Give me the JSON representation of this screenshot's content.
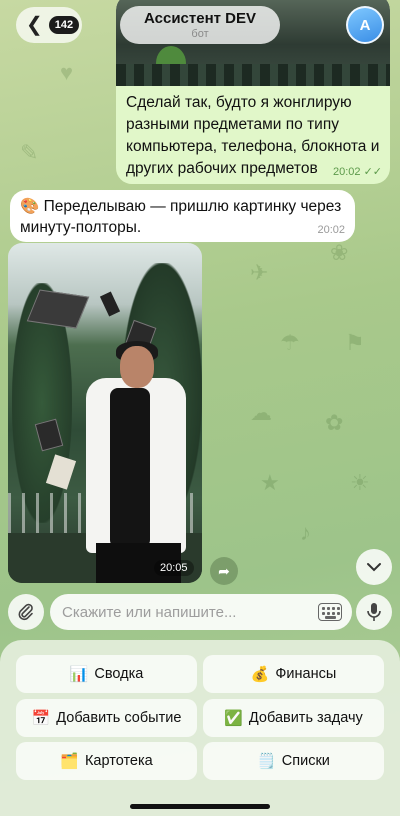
{
  "header": {
    "back_count": "142",
    "title": "Ассистент DEV",
    "subtitle": "бот",
    "avatar_letter": "A"
  },
  "messages": {
    "outgoing": {
      "text": "Сделай так, будто я жонглирую разными предметами по типу компьютера, телефона, блокнота и других рабочих предметов",
      "time": "20:02"
    },
    "incoming_text": {
      "emoji": "🎨",
      "text": "Переделываю — пришлю картинку через минуту-полторы.",
      "time": "20:02"
    },
    "incoming_photo": {
      "time": "20:05"
    }
  },
  "input": {
    "placeholder": "Скажите или напишите..."
  },
  "keyboard": {
    "buttons": [
      {
        "emoji": "📊",
        "label": "Сводка"
      },
      {
        "emoji": "💰",
        "label": "Финансы"
      },
      {
        "emoji": "📅",
        "label": "Добавить событие"
      },
      {
        "emoji": "✅",
        "label": "Добавить задачу"
      },
      {
        "emoji": "🗂️",
        "label": "Картотека"
      },
      {
        "emoji": "🗒️",
        "label": "Списки"
      }
    ]
  },
  "colors": {
    "outgoing_bubble": "#e1f7c9",
    "incoming_bubble": "#ffffff",
    "accent_time": "#5d9a4b"
  }
}
